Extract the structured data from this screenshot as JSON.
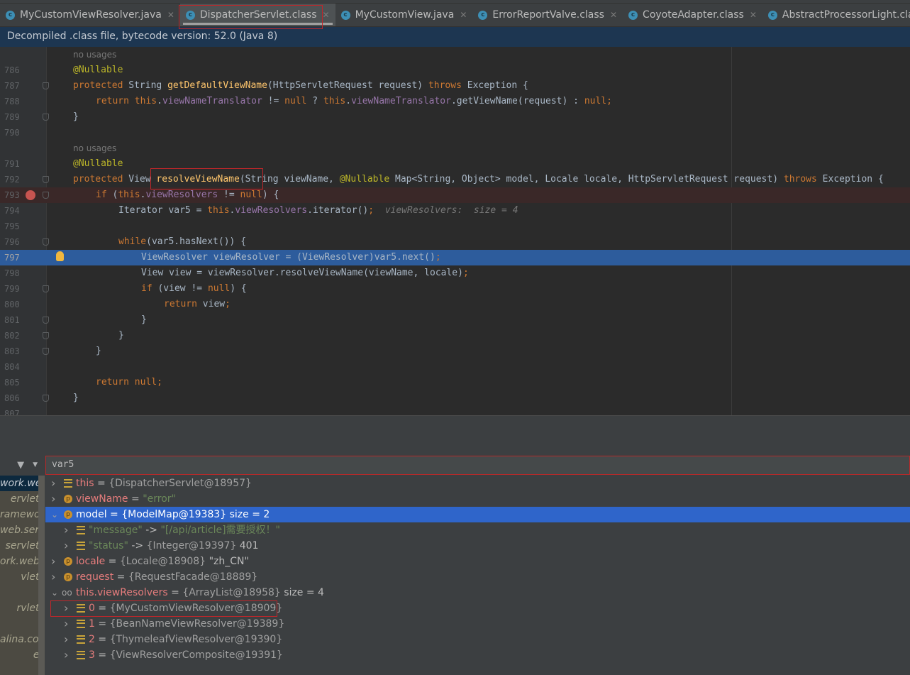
{
  "tabs": [
    {
      "label": "MyCustomViewResolver.java",
      "active": false
    },
    {
      "label": "DispatcherServlet.class",
      "active": true
    },
    {
      "label": "MyCustomView.java",
      "active": false
    },
    {
      "label": "ErrorReportValve.class",
      "active": false
    },
    {
      "label": "CoyoteAdapter.class",
      "active": false
    },
    {
      "label": "AbstractProcessorLight.class",
      "active": false
    }
  ],
  "banner": "Decompiled .class file, bytecode version: 52.0 (Java 8)",
  "code": [
    {
      "n": "",
      "fold": false,
      "indent": 0,
      "hint": "no usages"
    },
    {
      "n": "786",
      "indent": 0,
      "t": [
        [
          "@Nullable",
          "an"
        ]
      ]
    },
    {
      "n": "787",
      "fold": true,
      "indent": 0,
      "t": [
        [
          "protected ",
          "kw"
        ],
        [
          "String ",
          "pl"
        ],
        [
          "getDefaultViewName",
          "fn"
        ],
        [
          "(HttpServletRequest request) ",
          "pl"
        ],
        [
          "throws ",
          "kw"
        ],
        [
          "Exception {",
          "pl"
        ]
      ]
    },
    {
      "n": "788",
      "indent": 1,
      "t": [
        [
          "return ",
          "kw"
        ],
        [
          "this",
          "kw"
        ],
        [
          ".",
          "pl"
        ],
        [
          "viewNameTranslator",
          "fd"
        ],
        [
          " != ",
          "pl"
        ],
        [
          "null",
          "kw"
        ],
        [
          " ? ",
          "pl"
        ],
        [
          "this",
          "kw"
        ],
        [
          ".",
          "pl"
        ],
        [
          "viewNameTranslator",
          "fd"
        ],
        [
          ".getViewName(request) : ",
          "pl"
        ],
        [
          "null",
          "kw"
        ],
        [
          ";",
          "kw"
        ]
      ]
    },
    {
      "n": "789",
      "fold": true,
      "indent": 0,
      "t": [
        [
          "}",
          "pl"
        ]
      ]
    },
    {
      "n": "790",
      "indent": 0,
      "t": []
    },
    {
      "n": "",
      "indent": 0,
      "hint": "no usages"
    },
    {
      "n": "791",
      "indent": 0,
      "t": [
        [
          "@Nullable",
          "an"
        ]
      ]
    },
    {
      "n": "792",
      "fold": true,
      "indent": 0,
      "t": [
        [
          "protected ",
          "kw"
        ],
        [
          "View ",
          "pl"
        ],
        [
          "resolveViewName",
          "fn"
        ],
        [
          "(String viewName, ",
          "pl"
        ],
        [
          "@Nullable ",
          "an"
        ],
        [
          "Map<String, Object> model, Locale locale, HttpServletRequest request) ",
          "pl"
        ],
        [
          "throws ",
          "kw"
        ],
        [
          "Exception {",
          "pl"
        ]
      ]
    },
    {
      "n": "793",
      "fold": true,
      "bp": true,
      "indent": 1,
      "t": [
        [
          "if ",
          "kw"
        ],
        [
          "(",
          "pl"
        ],
        [
          "this",
          "kw"
        ],
        [
          ".",
          "pl"
        ],
        [
          "viewResolvers",
          "fd"
        ],
        [
          " != ",
          "pl"
        ],
        [
          "null",
          "kw"
        ],
        [
          ") {",
          "pl"
        ]
      ]
    },
    {
      "n": "794",
      "indent": 2,
      "t": [
        [
          "Iterator var5 = ",
          "pl"
        ],
        [
          "this",
          "kw"
        ],
        [
          ".",
          "pl"
        ],
        [
          "viewResolvers",
          "fd"
        ],
        [
          ".iterator()",
          "pl"
        ],
        [
          ";",
          "kw"
        ],
        [
          "  viewResolvers:  size = 4",
          "ht"
        ]
      ]
    },
    {
      "n": "795",
      "indent": 0,
      "t": []
    },
    {
      "n": "796",
      "fold": true,
      "indent": 2,
      "t": [
        [
          "while",
          "kw"
        ],
        [
          "(var5.hasNext()) {",
          "pl"
        ]
      ]
    },
    {
      "n": "797",
      "cur": true,
      "indent": 3,
      "t": [
        [
          "ViewResolver viewResolver = (ViewResolver)var5.next()",
          "pl"
        ],
        [
          ";",
          "kw"
        ]
      ]
    },
    {
      "n": "798",
      "indent": 3,
      "t": [
        [
          "View view = viewResolver.resolveViewName(viewName, locale)",
          "pl"
        ],
        [
          ";",
          "kw"
        ]
      ]
    },
    {
      "n": "799",
      "fold": true,
      "indent": 3,
      "t": [
        [
          "if ",
          "kw"
        ],
        [
          "(view != ",
          "pl"
        ],
        [
          "null",
          "kw"
        ],
        [
          ") {",
          "pl"
        ]
      ]
    },
    {
      "n": "800",
      "indent": 4,
      "t": [
        [
          "return ",
          "kw"
        ],
        [
          "view",
          "pl"
        ],
        [
          ";",
          "kw"
        ]
      ]
    },
    {
      "n": "801",
      "fold": true,
      "indent": 3,
      "t": [
        [
          "}",
          "pl"
        ]
      ]
    },
    {
      "n": "802",
      "fold": true,
      "indent": 2,
      "t": [
        [
          "}",
          "pl"
        ]
      ]
    },
    {
      "n": "803",
      "fold": true,
      "indent": 1,
      "t": [
        [
          "}",
          "pl"
        ]
      ]
    },
    {
      "n": "804",
      "indent": 0,
      "t": []
    },
    {
      "n": "805",
      "indent": 1,
      "t": [
        [
          "return ",
          "kw"
        ],
        [
          "null",
          "kw"
        ],
        [
          ";",
          "kw"
        ]
      ]
    },
    {
      "n": "806",
      "fold": true,
      "indent": 0,
      "t": [
        [
          "}",
          "pl"
        ]
      ]
    },
    {
      "n": "807",
      "indent": 0,
      "t": []
    }
  ],
  "debugger": {
    "watch_value": "var5",
    "frames": [
      "work.web",
      "ervlet)",
      "ramework",
      "web.servle",
      "servlet)",
      "ork.web.s",
      "vlet)",
      "",
      "rvlet)",
      "",
      "alina.core",
      "e)"
    ],
    "variables": [
      {
        "level": 0,
        "expanded": false,
        "icon": "list",
        "name": "this",
        "eq": " = ",
        "parts": [
          [
            "{DispatcherServlet@18957}",
            "ob"
          ]
        ]
      },
      {
        "level": 0,
        "expanded": false,
        "icon": "p",
        "name": "viewName",
        "eq": " = ",
        "parts": [
          [
            "\"error\"",
            "st"
          ]
        ]
      },
      {
        "level": 0,
        "expanded": true,
        "sel": true,
        "icon": "p",
        "name": "model",
        "eq": " = ",
        "parts": [
          [
            "{ModelMap@19383}",
            "ob"
          ],
          [
            "  size = 2",
            ""
          ]
        ]
      },
      {
        "level": 1,
        "expanded": false,
        "icon": "list",
        "name": "",
        "eq": "",
        "parts": [
          [
            "\"message\"",
            "st"
          ],
          [
            " -> ",
            ""
          ],
          [
            "\"[/api/article]需要授权！\"",
            "st"
          ]
        ]
      },
      {
        "level": 1,
        "expanded": false,
        "icon": "list",
        "name": "",
        "eq": "",
        "parts": [
          [
            "\"status\"",
            "st"
          ],
          [
            " -> ",
            ""
          ],
          [
            "{Integer@19397}",
            "ob"
          ],
          [
            " 401",
            ""
          ]
        ]
      },
      {
        "level": 0,
        "expanded": false,
        "icon": "p",
        "name": "locale",
        "eq": " = ",
        "parts": [
          [
            "{Locale@18908}",
            "ob"
          ],
          [
            " \"zh_CN\"",
            ""
          ]
        ]
      },
      {
        "level": 0,
        "expanded": false,
        "icon": "p",
        "name": "request",
        "eq": " = ",
        "parts": [
          [
            "{RequestFacade@18889}",
            "ob"
          ]
        ]
      },
      {
        "level": 0,
        "expanded": true,
        "icon": "oo",
        "name": "this.viewResolvers",
        "eq": " = ",
        "parts": [
          [
            "{ArrayList@18958}",
            "ob"
          ],
          [
            "  size = 4",
            ""
          ]
        ]
      },
      {
        "level": 1,
        "expanded": false,
        "icon": "list",
        "name": "0",
        "eq": " = ",
        "parts": [
          [
            "{MyCustomViewResolver@18909}",
            "ob"
          ]
        ]
      },
      {
        "level": 1,
        "expanded": false,
        "icon": "list",
        "name": "1",
        "eq": " = ",
        "parts": [
          [
            "{BeanNameViewResolver@19389}",
            "ob"
          ]
        ]
      },
      {
        "level": 1,
        "expanded": false,
        "icon": "list",
        "name": "2",
        "eq": " = ",
        "parts": [
          [
            "{ThymeleafViewResolver@19390}",
            "ob"
          ]
        ]
      },
      {
        "level": 1,
        "expanded": false,
        "icon": "list",
        "name": "3",
        "eq": " = ",
        "parts": [
          [
            "{ViewResolverComposite@19391}",
            "ob"
          ]
        ]
      }
    ]
  },
  "colors": {
    "keyword": "#cc7832",
    "annotation": "#bbb529",
    "method": "#ffc66d",
    "field": "#9876aa",
    "current_line": "#2d5c9c",
    "breakpoint": "#c75450",
    "highlight_box": "#c0262a"
  }
}
